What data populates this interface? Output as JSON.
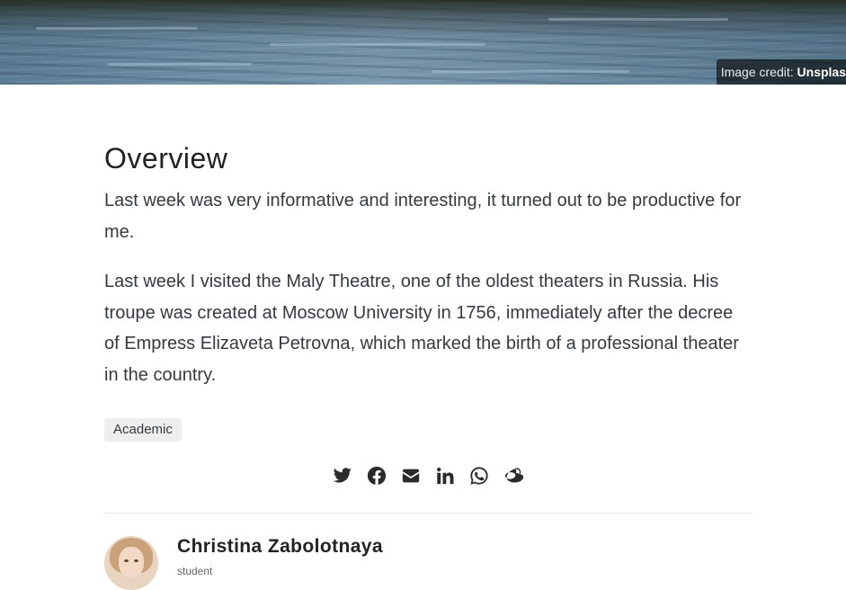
{
  "hero": {
    "credit_prefix": "Image credit: ",
    "credit_source": "Unsplas"
  },
  "article": {
    "heading": "Overview",
    "paragraphs": [
      "Last week was very informative and interesting, it turned out to be productive for me.",
      "Last week I visited the Maly Theatre, one of the oldest theaters in Russia. His troupe was created at Moscow University in 1756, immediately after the decree of Empress Elizaveta Petrovna, which marked the birth of a professional theater in the country."
    ],
    "tags": [
      "Academic"
    ]
  },
  "share": {
    "icons": [
      "twitter-icon",
      "facebook-icon",
      "email-icon",
      "linkedin-icon",
      "whatsapp-icon",
      "weibo-icon"
    ]
  },
  "author": {
    "name": "Christina Zabolotnaya",
    "subtitle": "student"
  },
  "colors": {
    "text": "#343a40",
    "heading": "#222222",
    "tag_bg": "#eeeeee",
    "icon": "#2b2b2b"
  }
}
